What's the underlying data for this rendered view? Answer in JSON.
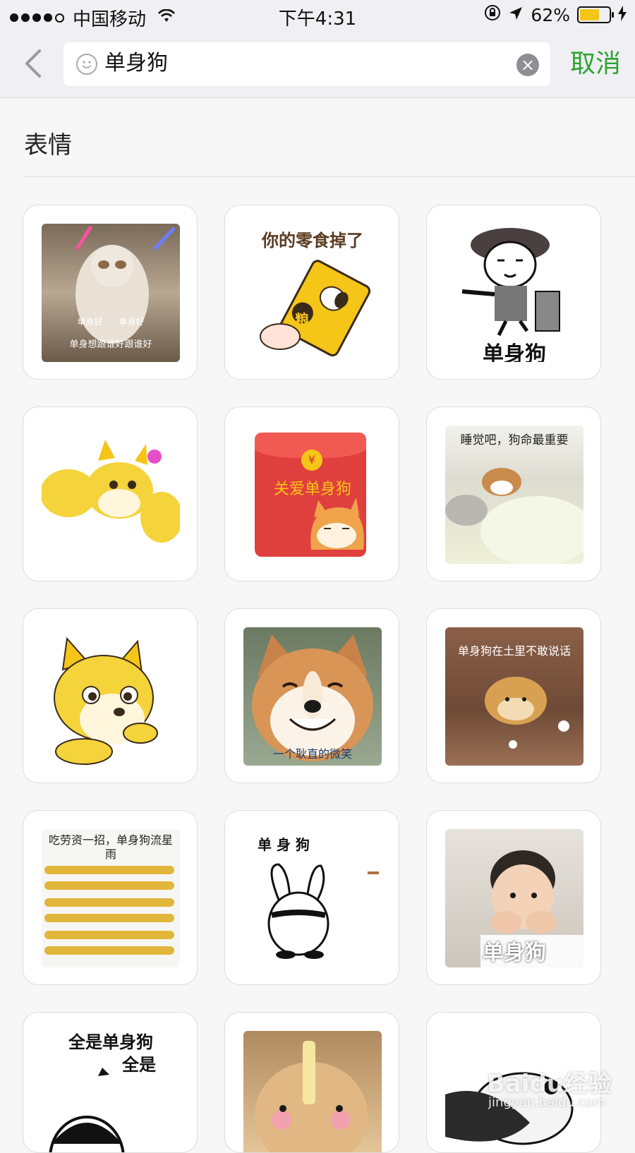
{
  "status": {
    "carrier": "中国移动",
    "time": "下午4:31",
    "battery": "62%"
  },
  "search": {
    "query": "单身狗",
    "cancel": "取消"
  },
  "section_title": "表情",
  "stickers": [
    {
      "texts": [
        "单身好",
        "单身好",
        "单身想跟谁好跟谁好"
      ]
    },
    {
      "texts": [
        "你的零食掉了",
        "粮"
      ]
    },
    {
      "texts": [
        "单身狗"
      ]
    },
    {
      "texts": []
    },
    {
      "texts": [
        "¥",
        "关爱单身狗"
      ]
    },
    {
      "texts": [
        "睡觉吧，狗命最重要"
      ]
    },
    {
      "texts": []
    },
    {
      "texts": [
        "一个耿直的微笑"
      ]
    },
    {
      "texts": [
        "单身狗在土里不敢说话"
      ]
    },
    {
      "texts": [
        "吃劳资一招，单身狗流星雨"
      ]
    },
    {
      "texts": [
        "单 身 狗"
      ]
    },
    {
      "texts": [
        "单身狗"
      ]
    },
    {
      "texts": [
        "全是单身狗",
        "全是"
      ]
    },
    {
      "texts": []
    },
    {
      "texts": []
    }
  ],
  "watermark": {
    "logo": "Baidu经验",
    "url": "jingyan.baidu.com"
  }
}
